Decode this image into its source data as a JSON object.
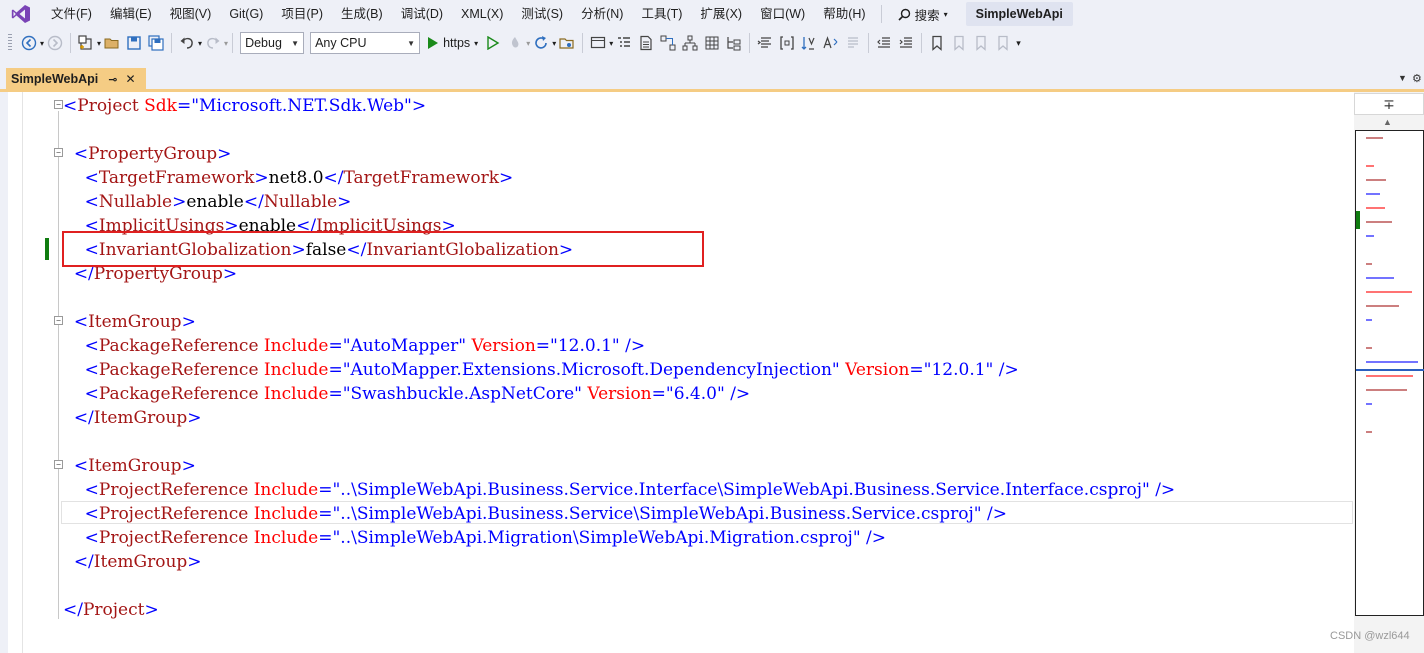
{
  "menu": {
    "items": [
      "文件(F)",
      "编辑(E)",
      "视图(V)",
      "Git(G)",
      "项目(P)",
      "生成(B)",
      "调试(D)",
      "XML(X)",
      "测试(S)",
      "分析(N)",
      "工具(T)",
      "扩展(X)",
      "窗口(W)",
      "帮助(H)"
    ],
    "search_label": "搜索",
    "solution_name": "SimpleWebApi"
  },
  "toolbar": {
    "configuration": "Debug",
    "platform": "Any CPU",
    "run_profile": "https"
  },
  "tab": {
    "title": "SimpleWebApi",
    "pin_glyph": "⊸",
    "close_glyph": "✕"
  },
  "editor": {
    "lines": [
      [
        [
          "br",
          "<"
        ],
        [
          "tag",
          "Project"
        ],
        [
          "txt",
          " "
        ],
        [
          "attr",
          "Sdk"
        ],
        [
          "br",
          "="
        ],
        [
          "val",
          "\"Microsoft.NET.Sdk.Web\""
        ],
        [
          "br",
          ">"
        ]
      ],
      [],
      [
        [
          "txt",
          "  "
        ],
        [
          "br",
          "<"
        ],
        [
          "tag",
          "PropertyGroup"
        ],
        [
          "br",
          ">"
        ]
      ],
      [
        [
          "txt",
          "    "
        ],
        [
          "br",
          "<"
        ],
        [
          "tag",
          "TargetFramework"
        ],
        [
          "br",
          ">"
        ],
        [
          "txt",
          "net8.0"
        ],
        [
          "br",
          "</"
        ],
        [
          "tag",
          "TargetFramework"
        ],
        [
          "br",
          ">"
        ]
      ],
      [
        [
          "txt",
          "    "
        ],
        [
          "br",
          "<"
        ],
        [
          "tag",
          "Nullable"
        ],
        [
          "br",
          ">"
        ],
        [
          "txt",
          "enable"
        ],
        [
          "br",
          "</"
        ],
        [
          "tag",
          "Nullable"
        ],
        [
          "br",
          ">"
        ]
      ],
      [
        [
          "txt",
          "    "
        ],
        [
          "br",
          "<"
        ],
        [
          "tag",
          "ImplicitUsings"
        ],
        [
          "br",
          ">"
        ],
        [
          "txt",
          "enable"
        ],
        [
          "br",
          "</"
        ],
        [
          "tag",
          "ImplicitUsings"
        ],
        [
          "br",
          ">"
        ]
      ],
      [
        [
          "txt",
          "    "
        ],
        [
          "br",
          "<"
        ],
        [
          "tag",
          "InvariantGlobalization"
        ],
        [
          "br",
          ">"
        ],
        [
          "txt",
          "false"
        ],
        [
          "br",
          "</"
        ],
        [
          "tag",
          "InvariantGlobalization"
        ],
        [
          "br",
          ">"
        ]
      ],
      [
        [
          "txt",
          "  "
        ],
        [
          "br",
          "</"
        ],
        [
          "tag",
          "PropertyGroup"
        ],
        [
          "br",
          ">"
        ]
      ],
      [],
      [
        [
          "txt",
          "  "
        ],
        [
          "br",
          "<"
        ],
        [
          "tag",
          "ItemGroup"
        ],
        [
          "br",
          ">"
        ]
      ],
      [
        [
          "txt",
          "    "
        ],
        [
          "br",
          "<"
        ],
        [
          "tag",
          "PackageReference"
        ],
        [
          "txt",
          " "
        ],
        [
          "attr",
          "Include"
        ],
        [
          "br",
          "="
        ],
        [
          "val",
          "\"AutoMapper\""
        ],
        [
          "txt",
          " "
        ],
        [
          "attr",
          "Version"
        ],
        [
          "br",
          "="
        ],
        [
          "val",
          "\"12.0.1\""
        ],
        [
          "txt",
          " "
        ],
        [
          "br",
          "/>"
        ]
      ],
      [
        [
          "txt",
          "    "
        ],
        [
          "br",
          "<"
        ],
        [
          "tag",
          "PackageReference"
        ],
        [
          "txt",
          " "
        ],
        [
          "attr",
          "Include"
        ],
        [
          "br",
          "="
        ],
        [
          "val",
          "\"AutoMapper.Extensions.Microsoft.DependencyInjection\""
        ],
        [
          "txt",
          " "
        ],
        [
          "attr",
          "Version"
        ],
        [
          "br",
          "="
        ],
        [
          "val",
          "\"12.0.1\""
        ],
        [
          "txt",
          " "
        ],
        [
          "br",
          "/>"
        ]
      ],
      [
        [
          "txt",
          "    "
        ],
        [
          "br",
          "<"
        ],
        [
          "tag",
          "PackageReference"
        ],
        [
          "txt",
          " "
        ],
        [
          "attr",
          "Include"
        ],
        [
          "br",
          "="
        ],
        [
          "val",
          "\"Swashbuckle.AspNetCore\""
        ],
        [
          "txt",
          " "
        ],
        [
          "attr",
          "Version"
        ],
        [
          "br",
          "="
        ],
        [
          "val",
          "\"6.4.0\""
        ],
        [
          "txt",
          " "
        ],
        [
          "br",
          "/>"
        ]
      ],
      [
        [
          "txt",
          "  "
        ],
        [
          "br",
          "</"
        ],
        [
          "tag",
          "ItemGroup"
        ],
        [
          "br",
          ">"
        ]
      ],
      [],
      [
        [
          "txt",
          "  "
        ],
        [
          "br",
          "<"
        ],
        [
          "tag",
          "ItemGroup"
        ],
        [
          "br",
          ">"
        ]
      ],
      [
        [
          "txt",
          "    "
        ],
        [
          "br",
          "<"
        ],
        [
          "tag",
          "ProjectReference"
        ],
        [
          "txt",
          " "
        ],
        [
          "attr",
          "Include"
        ],
        [
          "br",
          "="
        ],
        [
          "val",
          "\"..\\SimpleWebApi.Business.Service.Interface\\SimpleWebApi.Business.Service.Interface.csproj\""
        ],
        [
          "txt",
          " "
        ],
        [
          "br",
          "/>"
        ]
      ],
      [
        [
          "txt",
          "    "
        ],
        [
          "br",
          "<"
        ],
        [
          "tag",
          "ProjectReference"
        ],
        [
          "txt",
          " "
        ],
        [
          "attr",
          "Include"
        ],
        [
          "br",
          "="
        ],
        [
          "val",
          "\"..\\SimpleWebApi.Business.Service\\SimpleWebApi.Business.Service.csproj\""
        ],
        [
          "txt",
          " "
        ],
        [
          "br",
          "/>"
        ]
      ],
      [
        [
          "txt",
          "    "
        ],
        [
          "br",
          "<"
        ],
        [
          "tag",
          "ProjectReference"
        ],
        [
          "txt",
          " "
        ],
        [
          "attr",
          "Include"
        ],
        [
          "br",
          "="
        ],
        [
          "val",
          "\"..\\SimpleWebApi.Migration\\SimpleWebApi.Migration.csproj\""
        ],
        [
          "txt",
          " "
        ],
        [
          "br",
          "/>"
        ]
      ],
      [
        [
          "txt",
          "  "
        ],
        [
          "br",
          "</"
        ],
        [
          "tag",
          "ItemGroup"
        ],
        [
          "br",
          ">"
        ]
      ],
      [],
      [
        [
          "br",
          "</"
        ],
        [
          "tag",
          "Project"
        ],
        [
          "br",
          ">"
        ]
      ]
    ],
    "highlighted_line": 7,
    "current_line": 18
  },
  "watermark": "CSDN @wzl644",
  "colors": {
    "tag": "#a31515",
    "bracket": "#0000ff",
    "attribute": "#ff0000",
    "value": "#0000ff",
    "highlight_border": "#e02020",
    "active_tab": "#f5cc84",
    "change_mark": "#107c10"
  }
}
